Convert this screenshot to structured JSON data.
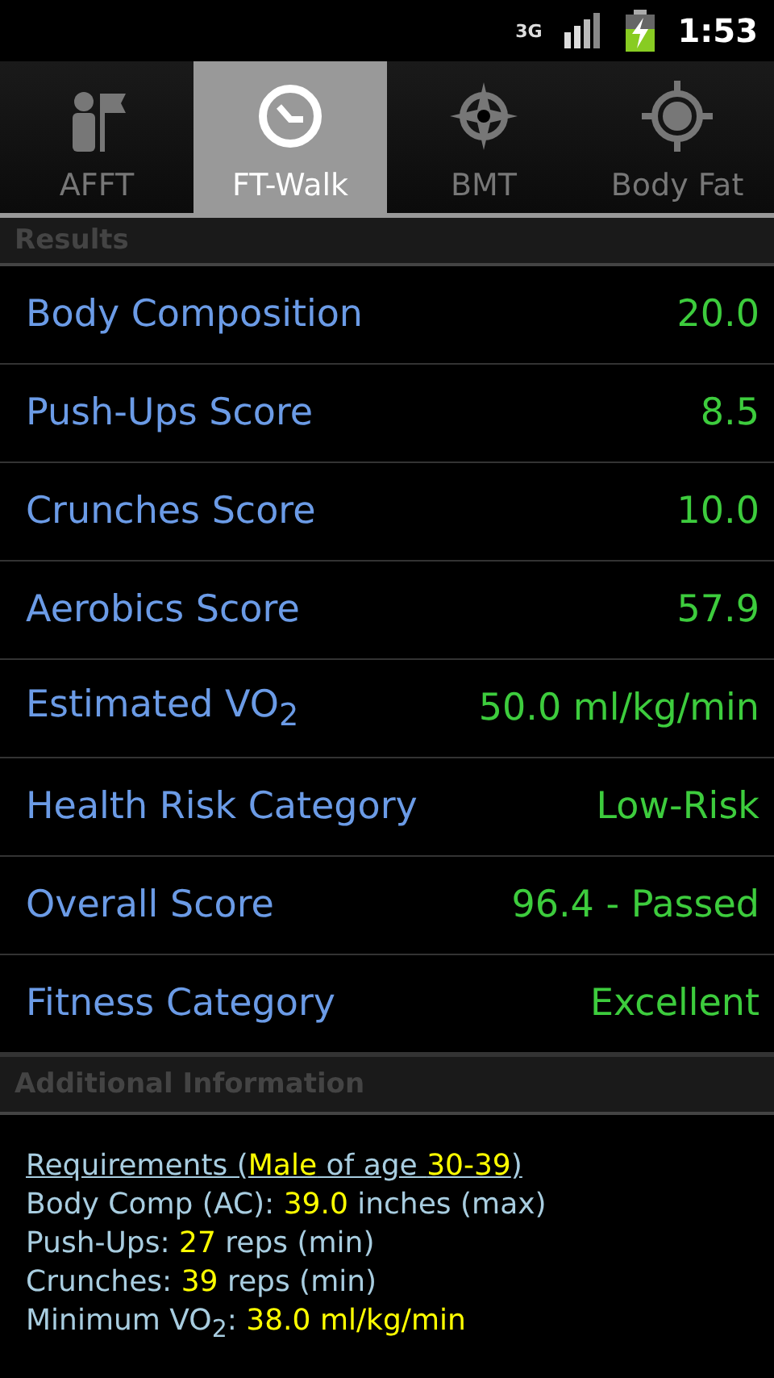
{
  "status_bar": {
    "network": "3G",
    "time": "1:53"
  },
  "tabs": [
    {
      "label": "AFFT",
      "selected": false
    },
    {
      "label": "FT-Walk",
      "selected": true
    },
    {
      "label": "BMT",
      "selected": false
    },
    {
      "label": "Body Fat",
      "selected": false
    }
  ],
  "results": {
    "title": "Results",
    "rows": [
      {
        "label": "Body Composition",
        "value": "20.0"
      },
      {
        "label": "Push-Ups Score",
        "value": "8.5"
      },
      {
        "label": "Crunches Score",
        "value": "10.0"
      },
      {
        "label": "Aerobics Score",
        "value": "57.9"
      },
      {
        "label": "Estimated VO$_{2}$",
        "value": "50.0 ml/kg/min"
      },
      {
        "label": "Health Risk Category",
        "value": "Low-Risk"
      },
      {
        "label": "Overall Score",
        "value": "96.4 - Passed"
      },
      {
        "label": "Fitness Category",
        "value": "Excellent"
      }
    ]
  },
  "additional": {
    "title": "Additional Information",
    "lines": [
      {
        "kind": "heading",
        "segments": [
          {
            "text": "Requirements (",
            "highlight": false
          },
          {
            "text": "Male",
            "highlight": true
          },
          {
            "text": " of age ",
            "highlight": false
          },
          {
            "text": "30-39",
            "highlight": true
          },
          {
            "text": ")",
            "highlight": false
          }
        ]
      },
      {
        "kind": "line",
        "segments": [
          {
            "text": "Body Comp (AC): ",
            "highlight": false
          },
          {
            "text": "39.0",
            "highlight": true
          },
          {
            "text": " inches (max)",
            "highlight": false
          }
        ]
      },
      {
        "kind": "line",
        "segments": [
          {
            "text": "Push-Ups: ",
            "highlight": false
          },
          {
            "text": "27",
            "highlight": true
          },
          {
            "text": " reps (min)",
            "highlight": false
          }
        ]
      },
      {
        "kind": "line",
        "segments": [
          {
            "text": "Crunches: ",
            "highlight": false
          },
          {
            "text": "39",
            "highlight": true
          },
          {
            "text": " reps (min)",
            "highlight": false
          }
        ]
      },
      {
        "kind": "line",
        "segments": [
          {
            "text": "Minimum VO$_{2}$: ",
            "highlight": false
          },
          {
            "text": "38.0 ml/kg/min",
            "highlight": true
          }
        ]
      }
    ]
  }
}
